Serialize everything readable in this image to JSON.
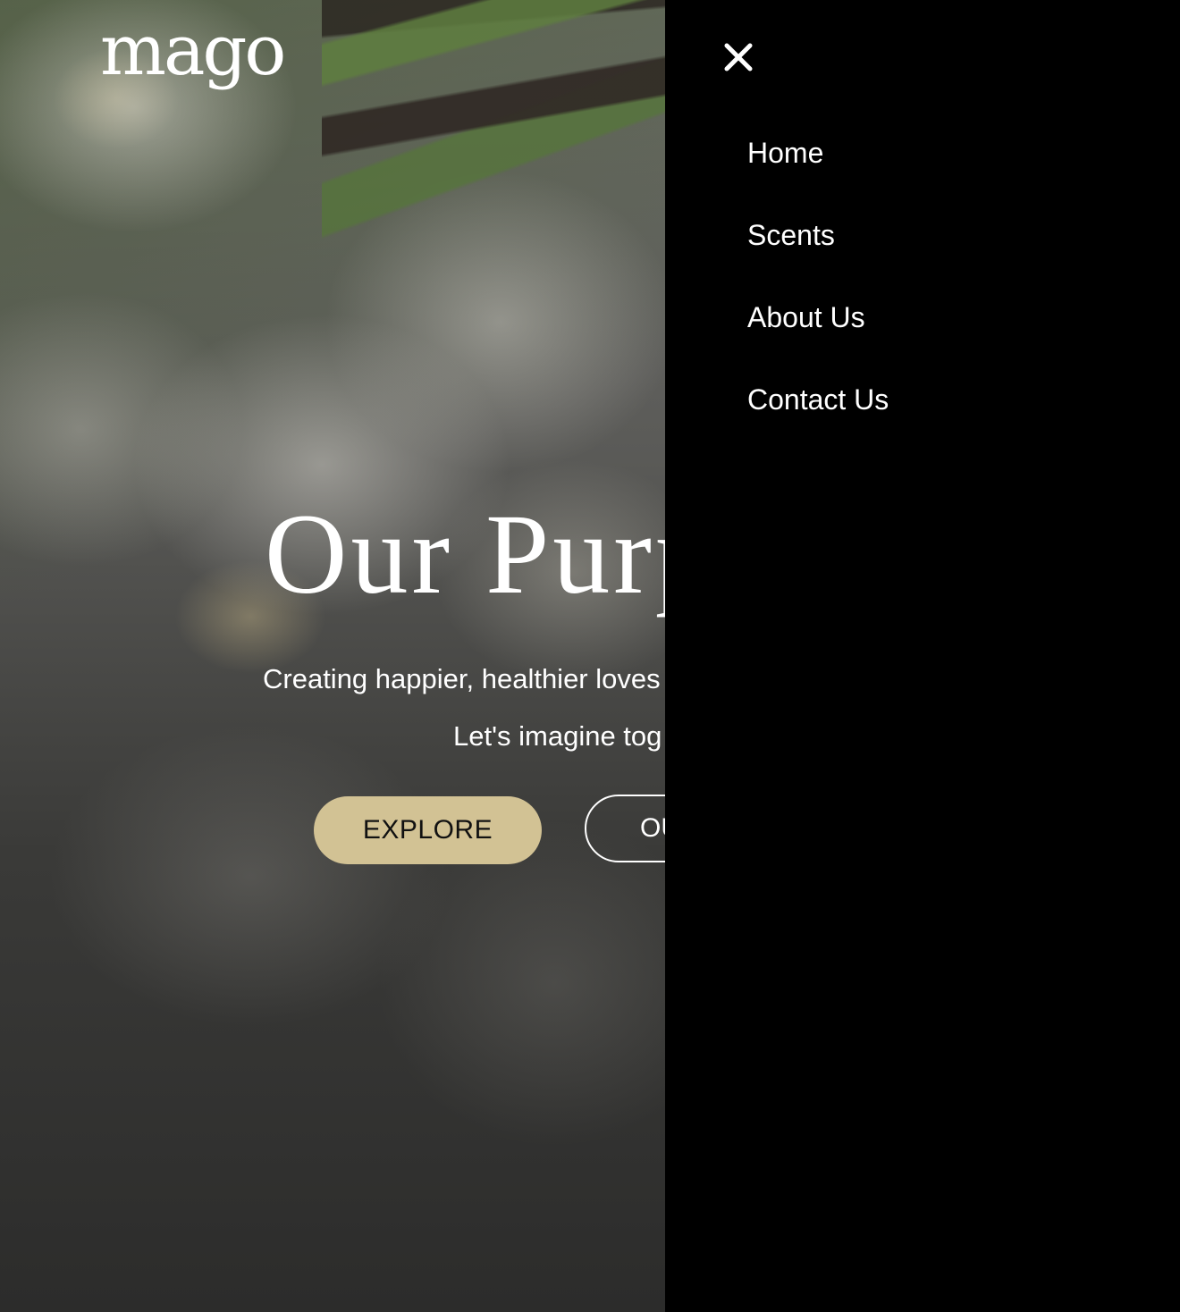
{
  "brand": {
    "logo_text": "mago"
  },
  "hero": {
    "title": "Our Purp",
    "subtitle": "Creating happier, healthier loves",
    "tagline": "Let's imagine tog",
    "explore_label": "EXPLORE",
    "outline_label": "OU"
  },
  "nav": {
    "close_icon": "close-icon",
    "items": [
      {
        "label": "Home"
      },
      {
        "label": "Scents"
      },
      {
        "label": "About Us"
      },
      {
        "label": "Contact Us"
      }
    ]
  },
  "colors": {
    "drawer_bg": "#000000",
    "accent": "#d2c294",
    "text": "#ffffff"
  }
}
